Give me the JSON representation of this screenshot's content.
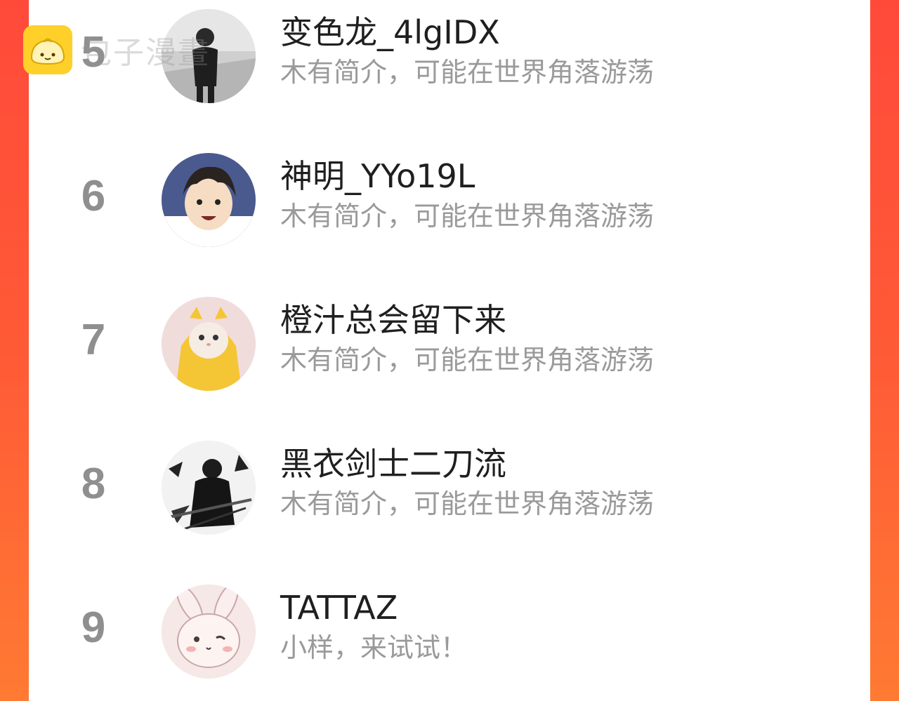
{
  "watermark": {
    "text": "包子漫畫",
    "icon": "bun-icon"
  },
  "rows": [
    {
      "rank": "5",
      "name": "变色龙_4lgIDX",
      "desc": "木有简介，可能在世界角落游荡"
    },
    {
      "rank": "6",
      "name": "神明_YYo19L",
      "desc": "木有简介，可能在世界角落游荡"
    },
    {
      "rank": "7",
      "name": "橙汁总会留下来",
      "desc": "木有简介，可能在世界角落游荡"
    },
    {
      "rank": "8",
      "name": "黑衣剑士二刀流",
      "desc": "木有简介，可能在世界角落游荡"
    },
    {
      "rank": "9",
      "name": "TATTAZ",
      "desc": "小样，来试试！"
    }
  ],
  "colors": {
    "background": "#ff4a3a",
    "card": "#ffffff",
    "rank": "#8f8f8f",
    "name": "#1f1f1f",
    "desc": "#9a9a9a",
    "logo": "#ffd02a"
  }
}
